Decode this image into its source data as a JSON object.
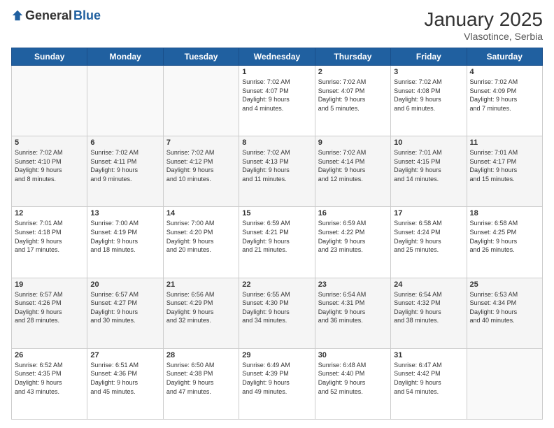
{
  "logo": {
    "general": "General",
    "blue": "Blue"
  },
  "title": "January 2025",
  "subtitle": "Vlasotince, Serbia",
  "days_header": [
    "Sunday",
    "Monday",
    "Tuesday",
    "Wednesday",
    "Thursday",
    "Friday",
    "Saturday"
  ],
  "weeks": [
    {
      "alt": false,
      "days": [
        {
          "num": "",
          "info": ""
        },
        {
          "num": "",
          "info": ""
        },
        {
          "num": "",
          "info": ""
        },
        {
          "num": "1",
          "info": "Sunrise: 7:02 AM\nSunset: 4:07 PM\nDaylight: 9 hours\nand 4 minutes."
        },
        {
          "num": "2",
          "info": "Sunrise: 7:02 AM\nSunset: 4:07 PM\nDaylight: 9 hours\nand 5 minutes."
        },
        {
          "num": "3",
          "info": "Sunrise: 7:02 AM\nSunset: 4:08 PM\nDaylight: 9 hours\nand 6 minutes."
        },
        {
          "num": "4",
          "info": "Sunrise: 7:02 AM\nSunset: 4:09 PM\nDaylight: 9 hours\nand 7 minutes."
        }
      ]
    },
    {
      "alt": true,
      "days": [
        {
          "num": "5",
          "info": "Sunrise: 7:02 AM\nSunset: 4:10 PM\nDaylight: 9 hours\nand 8 minutes."
        },
        {
          "num": "6",
          "info": "Sunrise: 7:02 AM\nSunset: 4:11 PM\nDaylight: 9 hours\nand 9 minutes."
        },
        {
          "num": "7",
          "info": "Sunrise: 7:02 AM\nSunset: 4:12 PM\nDaylight: 9 hours\nand 10 minutes."
        },
        {
          "num": "8",
          "info": "Sunrise: 7:02 AM\nSunset: 4:13 PM\nDaylight: 9 hours\nand 11 minutes."
        },
        {
          "num": "9",
          "info": "Sunrise: 7:02 AM\nSunset: 4:14 PM\nDaylight: 9 hours\nand 12 minutes."
        },
        {
          "num": "10",
          "info": "Sunrise: 7:01 AM\nSunset: 4:15 PM\nDaylight: 9 hours\nand 14 minutes."
        },
        {
          "num": "11",
          "info": "Sunrise: 7:01 AM\nSunset: 4:17 PM\nDaylight: 9 hours\nand 15 minutes."
        }
      ]
    },
    {
      "alt": false,
      "days": [
        {
          "num": "12",
          "info": "Sunrise: 7:01 AM\nSunset: 4:18 PM\nDaylight: 9 hours\nand 17 minutes."
        },
        {
          "num": "13",
          "info": "Sunrise: 7:00 AM\nSunset: 4:19 PM\nDaylight: 9 hours\nand 18 minutes."
        },
        {
          "num": "14",
          "info": "Sunrise: 7:00 AM\nSunset: 4:20 PM\nDaylight: 9 hours\nand 20 minutes."
        },
        {
          "num": "15",
          "info": "Sunrise: 6:59 AM\nSunset: 4:21 PM\nDaylight: 9 hours\nand 21 minutes."
        },
        {
          "num": "16",
          "info": "Sunrise: 6:59 AM\nSunset: 4:22 PM\nDaylight: 9 hours\nand 23 minutes."
        },
        {
          "num": "17",
          "info": "Sunrise: 6:58 AM\nSunset: 4:24 PM\nDaylight: 9 hours\nand 25 minutes."
        },
        {
          "num": "18",
          "info": "Sunrise: 6:58 AM\nSunset: 4:25 PM\nDaylight: 9 hours\nand 26 minutes."
        }
      ]
    },
    {
      "alt": true,
      "days": [
        {
          "num": "19",
          "info": "Sunrise: 6:57 AM\nSunset: 4:26 PM\nDaylight: 9 hours\nand 28 minutes."
        },
        {
          "num": "20",
          "info": "Sunrise: 6:57 AM\nSunset: 4:27 PM\nDaylight: 9 hours\nand 30 minutes."
        },
        {
          "num": "21",
          "info": "Sunrise: 6:56 AM\nSunset: 4:29 PM\nDaylight: 9 hours\nand 32 minutes."
        },
        {
          "num": "22",
          "info": "Sunrise: 6:55 AM\nSunset: 4:30 PM\nDaylight: 9 hours\nand 34 minutes."
        },
        {
          "num": "23",
          "info": "Sunrise: 6:54 AM\nSunset: 4:31 PM\nDaylight: 9 hours\nand 36 minutes."
        },
        {
          "num": "24",
          "info": "Sunrise: 6:54 AM\nSunset: 4:32 PM\nDaylight: 9 hours\nand 38 minutes."
        },
        {
          "num": "25",
          "info": "Sunrise: 6:53 AM\nSunset: 4:34 PM\nDaylight: 9 hours\nand 40 minutes."
        }
      ]
    },
    {
      "alt": false,
      "days": [
        {
          "num": "26",
          "info": "Sunrise: 6:52 AM\nSunset: 4:35 PM\nDaylight: 9 hours\nand 43 minutes."
        },
        {
          "num": "27",
          "info": "Sunrise: 6:51 AM\nSunset: 4:36 PM\nDaylight: 9 hours\nand 45 minutes."
        },
        {
          "num": "28",
          "info": "Sunrise: 6:50 AM\nSunset: 4:38 PM\nDaylight: 9 hours\nand 47 minutes."
        },
        {
          "num": "29",
          "info": "Sunrise: 6:49 AM\nSunset: 4:39 PM\nDaylight: 9 hours\nand 49 minutes."
        },
        {
          "num": "30",
          "info": "Sunrise: 6:48 AM\nSunset: 4:40 PM\nDaylight: 9 hours\nand 52 minutes."
        },
        {
          "num": "31",
          "info": "Sunrise: 6:47 AM\nSunset: 4:42 PM\nDaylight: 9 hours\nand 54 minutes."
        },
        {
          "num": "",
          "info": ""
        }
      ]
    }
  ]
}
